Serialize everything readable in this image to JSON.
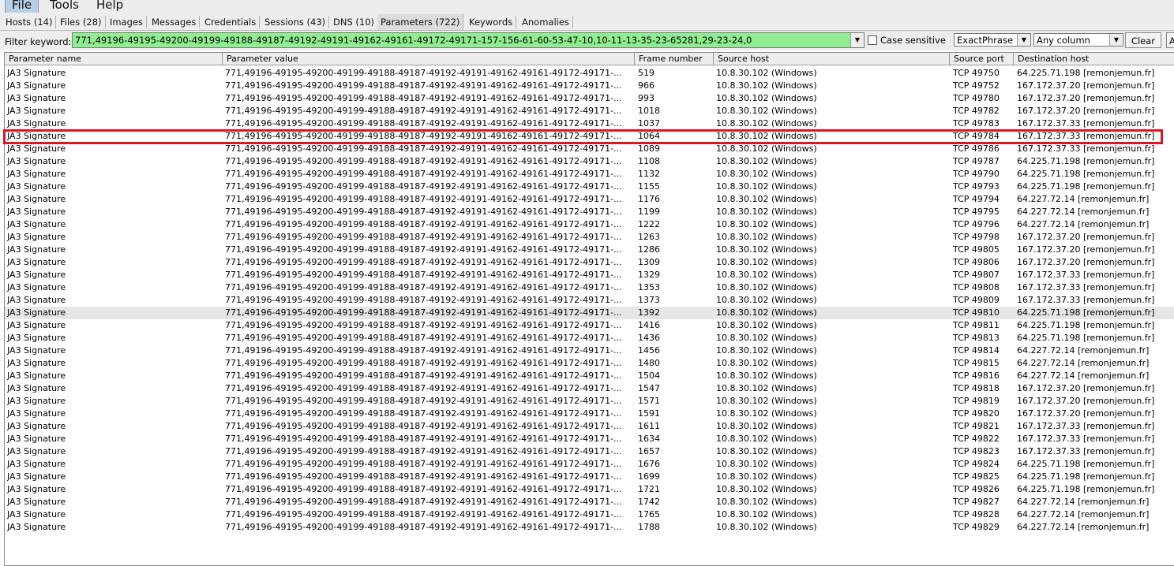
{
  "menu": {
    "items": [
      "File",
      "Tools",
      "Help"
    ],
    "active": "File"
  },
  "tabs": [
    "Hosts (14)",
    "Files (28)",
    "Images",
    "Messages",
    "Credentials",
    "Sessions (43)",
    "DNS (10)",
    "Parameters (722)",
    "Keywords",
    "Anomalies"
  ],
  "active_tab": "Parameters (722)",
  "filter": {
    "label": "Filter keyword:",
    "value": "771,49196-49195-49200-49199-49188-49187-49192-49191-49162-49161-49172-49171-157-156-61-60-53-47-10,10-11-13-35-23-65281,29-23-24,0",
    "case_sensitive_label": "Case sensitive",
    "match_mode": "ExactPhrase",
    "column_scope": "Any column",
    "clear_label": "Clear",
    "more_label": "A"
  },
  "table": {
    "columns": [
      "Parameter name",
      "Parameter value",
      "Frame number",
      "Source host",
      "Source port",
      "Destination host"
    ],
    "rows": [
      [
        "JA3 Signature",
        "771,49196-49195-49200-49199-49188-49187-49192-49191-49162-49161-49172-49171-...",
        "519",
        "10.8.30.102 (Windows)",
        "TCP 49750",
        "64.225.71.198 [remonjemun.fr]"
      ],
      [
        "JA3 Signature",
        "771,49196-49195-49200-49199-49188-49187-49192-49191-49162-49161-49172-49171-...",
        "966",
        "10.8.30.102 (Windows)",
        "TCP 49752",
        "167.172.37.20 [remonjemun.fr]"
      ],
      [
        "JA3 Signature",
        "771,49196-49195-49200-49199-49188-49187-49192-49191-49162-49161-49172-49171-...",
        "993",
        "10.8.30.102 (Windows)",
        "TCP 49780",
        "167.172.37.20 [remonjemun.fr]"
      ],
      [
        "JA3 Signature",
        "771,49196-49195-49200-49199-49188-49187-49192-49191-49162-49161-49172-49171-...",
        "1018",
        "10.8.30.102 (Windows)",
        "TCP 49782",
        "167.172.37.20 [remonjemun.fr]"
      ],
      [
        "JA3 Signature",
        "771,49196-49195-49200-49199-49188-49187-49192-49191-49162-49161-49172-49171-...",
        "1037",
        "10.8.30.102 (Windows)",
        "TCP 49783",
        "167.172.37.33 [remonjemun.fr]"
      ],
      [
        "JA3 Signature",
        "771,49196-49195-49200-49199-49188-49187-49192-49191-49162-49161-49172-49171-...",
        "1064",
        "10.8.30.102 (Windows)",
        "TCP 49784",
        "167.172.37.33 [remonjemun.fr]"
      ],
      [
        "JA3 Signature",
        "771,49196-49195-49200-49199-49188-49187-49192-49191-49162-49161-49172-49171-...",
        "1089",
        "10.8.30.102 (Windows)",
        "TCP 49786",
        "167.172.37.33 [remonjemun.fr]"
      ],
      [
        "JA3 Signature",
        "771,49196-49195-49200-49199-49188-49187-49192-49191-49162-49161-49172-49171-...",
        "1108",
        "10.8.30.102 (Windows)",
        "TCP 49787",
        "64.225.71.198 [remonjemun.fr]"
      ],
      [
        "JA3 Signature",
        "771,49196-49195-49200-49199-49188-49187-49192-49191-49162-49161-49172-49171-...",
        "1132",
        "10.8.30.102 (Windows)",
        "TCP 49790",
        "64.225.71.198 [remonjemun.fr]"
      ],
      [
        "JA3 Signature",
        "771,49196-49195-49200-49199-49188-49187-49192-49191-49162-49161-49172-49171-...",
        "1155",
        "10.8.30.102 (Windows)",
        "TCP 49793",
        "64.225.71.198 [remonjemun.fr]"
      ],
      [
        "JA3 Signature",
        "771,49196-49195-49200-49199-49188-49187-49192-49191-49162-49161-49172-49171-...",
        "1176",
        "10.8.30.102 (Windows)",
        "TCP 49794",
        "64.227.72.14 [remonjemun.fr]"
      ],
      [
        "JA3 Signature",
        "771,49196-49195-49200-49199-49188-49187-49192-49191-49162-49161-49172-49171-...",
        "1199",
        "10.8.30.102 (Windows)",
        "TCP 49795",
        "64.227.72.14 [remonjemun.fr]"
      ],
      [
        "JA3 Signature",
        "771,49196-49195-49200-49199-49188-49187-49192-49191-49162-49161-49172-49171-...",
        "1222",
        "10.8.30.102 (Windows)",
        "TCP 49796",
        "64.227.72.14 [remonjemun.fr]"
      ],
      [
        "JA3 Signature",
        "771,49196-49195-49200-49199-49188-49187-49192-49191-49162-49161-49172-49171-...",
        "1263",
        "10.8.30.102 (Windows)",
        "TCP 49798",
        "167.172.37.20 [remonjemun.fr]"
      ],
      [
        "JA3 Signature",
        "771,49196-49195-49200-49199-49188-49187-49192-49191-49162-49161-49172-49171-...",
        "1286",
        "10.8.30.102 (Windows)",
        "TCP 49805",
        "167.172.37.20 [remonjemun.fr]"
      ],
      [
        "JA3 Signature",
        "771,49196-49195-49200-49199-49188-49187-49192-49191-49162-49161-49172-49171-...",
        "1309",
        "10.8.30.102 (Windows)",
        "TCP 49806",
        "167.172.37.20 [remonjemun.fr]"
      ],
      [
        "JA3 Signature",
        "771,49196-49195-49200-49199-49188-49187-49192-49191-49162-49161-49172-49171-...",
        "1329",
        "10.8.30.102 (Windows)",
        "TCP 49807",
        "167.172.37.33 [remonjemun.fr]"
      ],
      [
        "JA3 Signature",
        "771,49196-49195-49200-49199-49188-49187-49192-49191-49162-49161-49172-49171-...",
        "1353",
        "10.8.30.102 (Windows)",
        "TCP 49808",
        "167.172.37.33 [remonjemun.fr]"
      ],
      [
        "JA3 Signature",
        "771,49196-49195-49200-49199-49188-49187-49192-49191-49162-49161-49172-49171-...",
        "1373",
        "10.8.30.102 (Windows)",
        "TCP 49809",
        "167.172.37.33 [remonjemun.fr]"
      ],
      [
        "JA3 Signature",
        "771,49196-49195-49200-49199-49188-49187-49192-49191-49162-49161-49172-49171-...",
        "1392",
        "10.8.30.102 (Windows)",
        "TCP 49810",
        "64.225.71.198 [remonjemun.fr]"
      ],
      [
        "JA3 Signature",
        "771,49196-49195-49200-49199-49188-49187-49192-49191-49162-49161-49172-49171-...",
        "1416",
        "10.8.30.102 (Windows)",
        "TCP 49811",
        "64.225.71.198 [remonjemun.fr]"
      ],
      [
        "JA3 Signature",
        "771,49196-49195-49200-49199-49188-49187-49192-49191-49162-49161-49172-49171-...",
        "1436",
        "10.8.30.102 (Windows)",
        "TCP 49813",
        "64.225.71.198 [remonjemun.fr]"
      ],
      [
        "JA3 Signature",
        "771,49196-49195-49200-49199-49188-49187-49192-49191-49162-49161-49172-49171-...",
        "1456",
        "10.8.30.102 (Windows)",
        "TCP 49814",
        "64.227.72.14 [remonjemun.fr]"
      ],
      [
        "JA3 Signature",
        "771,49196-49195-49200-49199-49188-49187-49192-49191-49162-49161-49172-49171-...",
        "1480",
        "10.8.30.102 (Windows)",
        "TCP 49815",
        "64.227.72.14 [remonjemun.fr]"
      ],
      [
        "JA3 Signature",
        "771,49196-49195-49200-49199-49188-49187-49192-49191-49162-49161-49172-49171-...",
        "1504",
        "10.8.30.102 (Windows)",
        "TCP 49816",
        "64.227.72.14 [remonjemun.fr]"
      ],
      [
        "JA3 Signature",
        "771,49196-49195-49200-49199-49188-49187-49192-49191-49162-49161-49172-49171-...",
        "1547",
        "10.8.30.102 (Windows)",
        "TCP 49818",
        "167.172.37.20 [remonjemun.fr]"
      ],
      [
        "JA3 Signature",
        "771,49196-49195-49200-49199-49188-49187-49192-49191-49162-49161-49172-49171-...",
        "1571",
        "10.8.30.102 (Windows)",
        "TCP 49819",
        "167.172.37.20 [remonjemun.fr]"
      ],
      [
        "JA3 Signature",
        "771,49196-49195-49200-49199-49188-49187-49192-49191-49162-49161-49172-49171-...",
        "1591",
        "10.8.30.102 (Windows)",
        "TCP 49820",
        "167.172.37.20 [remonjemun.fr]"
      ],
      [
        "JA3 Signature",
        "771,49196-49195-49200-49199-49188-49187-49192-49191-49162-49161-49172-49171-...",
        "1611",
        "10.8.30.102 (Windows)",
        "TCP 49821",
        "167.172.37.33 [remonjemun.fr]"
      ],
      [
        "JA3 Signature",
        "771,49196-49195-49200-49199-49188-49187-49192-49191-49162-49161-49172-49171-...",
        "1634",
        "10.8.30.102 (Windows)",
        "TCP 49822",
        "167.172.37.33 [remonjemun.fr]"
      ],
      [
        "JA3 Signature",
        "771,49196-49195-49200-49199-49188-49187-49192-49191-49162-49161-49172-49171-...",
        "1657",
        "10.8.30.102 (Windows)",
        "TCP 49823",
        "167.172.37.33 [remonjemun.fr]"
      ],
      [
        "JA3 Signature",
        "771,49196-49195-49200-49199-49188-49187-49192-49191-49162-49161-49172-49171-...",
        "1676",
        "10.8.30.102 (Windows)",
        "TCP 49824",
        "64.225.71.198 [remonjemun.fr]"
      ],
      [
        "JA3 Signature",
        "771,49196-49195-49200-49199-49188-49187-49192-49191-49162-49161-49172-49171-...",
        "1699",
        "10.8.30.102 (Windows)",
        "TCP 49825",
        "64.225.71.198 [remonjemun.fr]"
      ],
      [
        "JA3 Signature",
        "771,49196-49195-49200-49199-49188-49187-49192-49191-49162-49161-49172-49171-...",
        "1721",
        "10.8.30.102 (Windows)",
        "TCP 49826",
        "64.225.71.198 [remonjemun.fr]"
      ],
      [
        "JA3 Signature",
        "771,49196-49195-49200-49199-49188-49187-49192-49191-49162-49161-49172-49171-...",
        "1742",
        "10.8.30.102 (Windows)",
        "TCP 49827",
        "64.227.72.14 [remonjemun.fr]"
      ],
      [
        "JA3 Signature",
        "771,49196-49195-49200-49199-49188-49187-49192-49191-49162-49161-49172-49171-...",
        "1765",
        "10.8.30.102 (Windows)",
        "TCP 49828",
        "64.227.72.14 [remonjemun.fr]"
      ],
      [
        "JA3 Signature",
        "771,49196-49195-49200-49199-49188-49187-49192-49191-49162-49161-49172-49171-...",
        "1788",
        "10.8.30.102 (Windows)",
        "TCP 49829",
        "64.227.72.14 [remonjemun.fr]"
      ]
    ],
    "selected_row_index": 19,
    "highlighted_row_index": 5
  },
  "colors": {
    "filter_match_bg": "#90ee90",
    "highlight_border": "#e0141e",
    "selected_row_bg": "#e6e6e6"
  }
}
